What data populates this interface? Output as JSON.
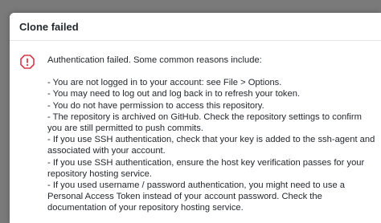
{
  "dialog": {
    "title": "Clone failed",
    "icon": "octagon-alert-icon",
    "icon_color": "#d73a49",
    "intro": "Authentication failed. Some common reasons include:",
    "reasons": [
      "- You are not logged in to your account: see File > Options.",
      "- You may need to log out and log back in to refresh your token.",
      "- You do not have permission to access this repository.",
      "- The repository is archived on GitHub. Check the repository settings to confirm you are still permitted to push commits.",
      "- If you use SSH authentication, check that your key is added to the ssh-agent and associated with your account.",
      "- If you use SSH authentication, ensure the host key verification passes for your repository hosting service.",
      "- If you used username / password authentication, you might need to use a Personal Access Token instead of your account password. Check the documentation of your repository hosting service."
    ]
  }
}
